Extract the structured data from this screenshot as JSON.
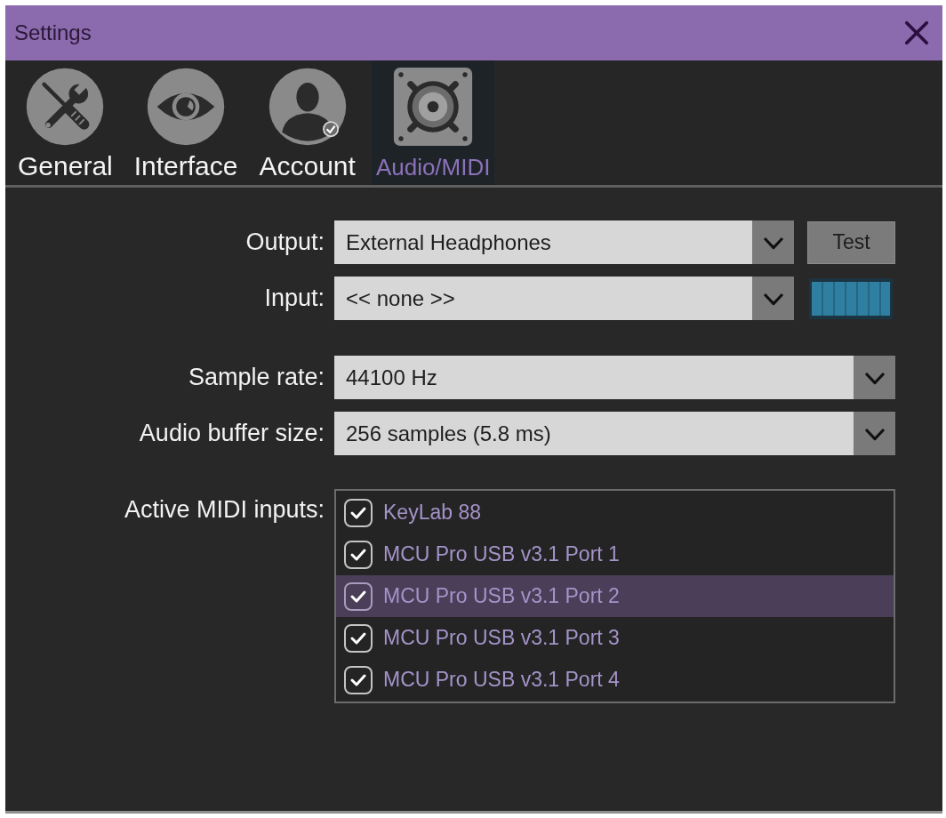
{
  "window": {
    "title": "Settings"
  },
  "tabs": [
    {
      "label": "General",
      "selected": false
    },
    {
      "label": "Interface",
      "selected": false
    },
    {
      "label": "Account",
      "selected": false
    },
    {
      "label": "Audio/MIDI",
      "selected": true
    }
  ],
  "audio_midi": {
    "output": {
      "label": "Output:",
      "value": "External Headphones",
      "button": "Test"
    },
    "input": {
      "label": "Input:",
      "value": "<< none >>",
      "meter": {
        "level": 1
      }
    },
    "sample_rate": {
      "label": "Sample rate:",
      "value": "44100 Hz"
    },
    "buffer_size": {
      "label": "Audio buffer size:",
      "value": "256 samples (5.8 ms)"
    },
    "midi_inputs": {
      "label": "Active MIDI inputs:",
      "items": [
        {
          "name": "KeyLab 88",
          "checked": true,
          "selected": false
        },
        {
          "name": "MCU Pro USB v3.1 Port 1",
          "checked": true,
          "selected": false
        },
        {
          "name": "MCU Pro USB v3.1 Port 2",
          "checked": true,
          "selected": true
        },
        {
          "name": "MCU Pro USB v3.1 Port 3",
          "checked": true,
          "selected": false
        },
        {
          "name": "MCU Pro USB v3.1 Port 4",
          "checked": true,
          "selected": false
        }
      ]
    }
  }
}
